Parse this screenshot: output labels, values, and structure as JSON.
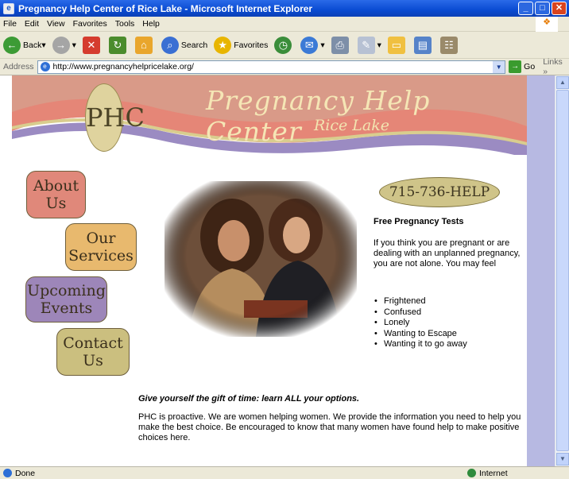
{
  "window": {
    "title": "Pregnancy Help Center of Rice Lake - Microsoft Internet Explorer"
  },
  "menu": [
    "File",
    "Edit",
    "View",
    "Favorites",
    "Tools",
    "Help"
  ],
  "toolbar": {
    "back": "Back",
    "search": "Search",
    "favorites": "Favorites"
  },
  "address": {
    "label": "Address",
    "url": "http://www.pregnancyhelpricelake.org/",
    "go": "Go",
    "links": "Links"
  },
  "status": {
    "left": "Done",
    "zone": "Internet"
  },
  "site": {
    "title": "Pregnancy Help Center",
    "subtitle": "Rice Lake",
    "logo": "PHC",
    "phone": "715-736-HELP",
    "nav": [
      {
        "label": "About Us",
        "color": "#e0887a"
      },
      {
        "label": "Our Services",
        "color": "#e8b96e"
      },
      {
        "label": "Upcoming Events",
        "color": "#9d86b9"
      },
      {
        "label": "Contact Us",
        "color": "#cbbf7f"
      }
    ],
    "heading": "Free Pregnancy Tests",
    "intro": "If you think you are pregnant or are dealing with an unplanned pregnancy, you are not alone. You may feel",
    "feelings": [
      "Frightened",
      "Confused",
      "Lonely",
      "Wanting to Escape",
      "Wanting it to go away"
    ],
    "gift": "Give yourself the gift of time: learn ALL your options.",
    "about": "PHC is proactive. We are women helping women. We provide the information you need to help you make the best choice. Be encouraged to know that many women have found help to make positive choices here."
  }
}
